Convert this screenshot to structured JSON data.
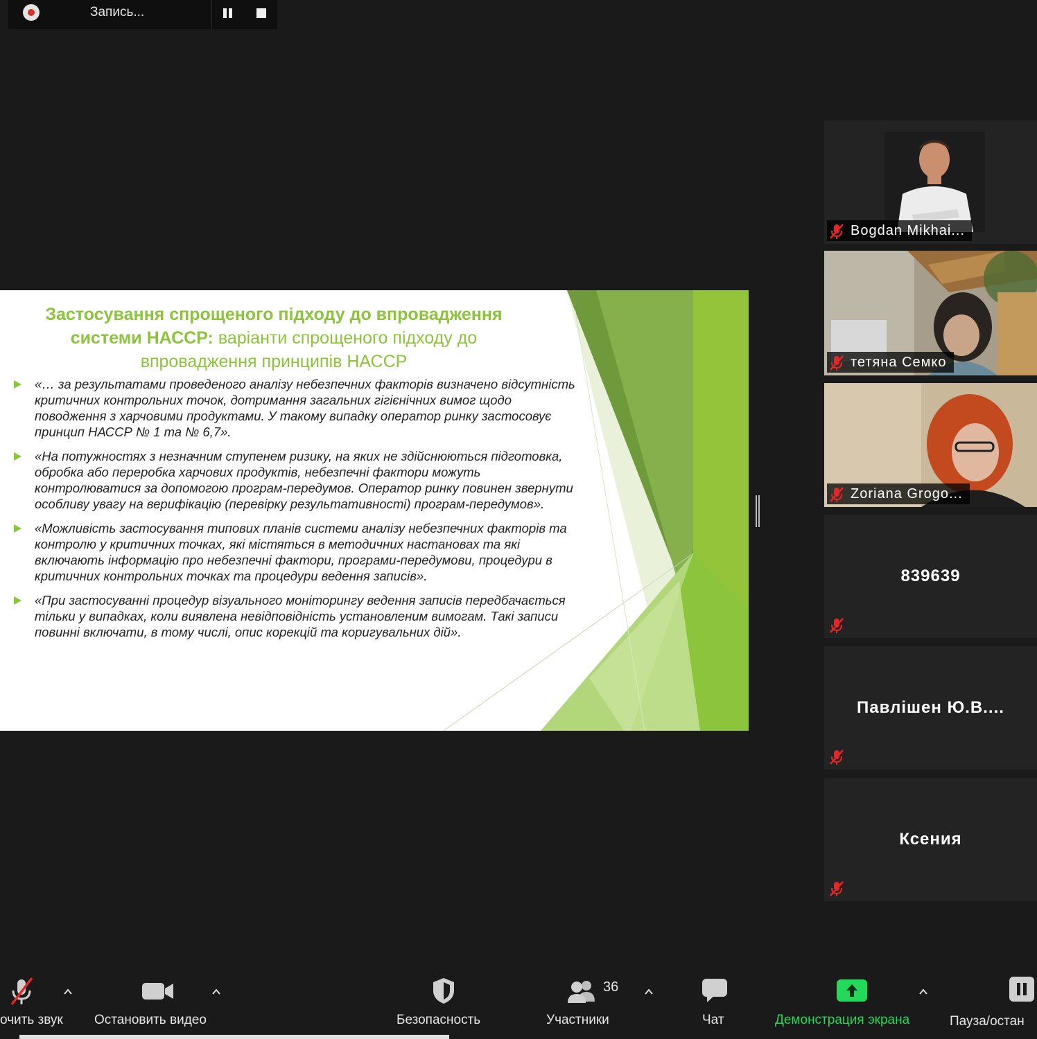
{
  "recording": {
    "label": "Запись..."
  },
  "slide": {
    "title_line1": "Застосування спрощеного підходу до впровадження",
    "title_line2_bold": "системи НАССР:",
    "title_line2_rest": "варіанти спрощеного підходу до",
    "title_line3": "впровадження принципів НАССР",
    "bullets": [
      "«… за результатами проведеного аналізу небезпечних факторів визначено відсутність критичних контрольних точок, дотримання загальних гігієнічних вимог щодо поводження з харчовими продуктами. У такому випадку оператор ринку застосовує принцип НАССР № 1 та № 6,7».",
      "«На потужностях з незначним ступенем ризику, на яких не здійснюються підготовка, обробка або переробка харчових продуктів, небезпечні фактори можуть контролюватися за допомогою програм-передумов. Оператор ринку повинен звернути особливу увагу на верифікацію (перевірку результативності) програм-передумов».",
      "«Можливість застосування типових планів системи аналізу небезпечних факторів та контролю у критичних точках, які містяться в методичних настановах та які включають інформацію про небезпечні фактори, програми-передумови, процедури в критичних контрольних точках та процедури ведення записів».",
      "«При застосуванні процедур візуального моніторингу ведення записів передбачається тільки у випадках, коли виявлена невідповідність установленим вимогам. Такі записи повинні включати, в тому числі, опис корекцій та коригувальних дій»."
    ],
    "accent_color": "#8cc43c"
  },
  "participants": [
    {
      "name": "Bogdan Mikhai...",
      "video": true
    },
    {
      "name": "тетяна Семко",
      "video": true
    },
    {
      "name": "Zoriana Grogo...",
      "video": true
    },
    {
      "name": "839639",
      "video": false
    },
    {
      "name": "Павлішен Ю.В....",
      "video": false
    },
    {
      "name": "Ксения",
      "video": false
    }
  ],
  "toolbar": {
    "unmute_label": "очить звук",
    "video_label": "Остановить видео",
    "security_label": "Безопасность",
    "participants_label": "Участники",
    "participants_count": "36",
    "chat_label": "Чат",
    "share_label": "Демонстрация экрана",
    "pause_label": "Пауза/остан",
    "share_color": "#23d959"
  }
}
